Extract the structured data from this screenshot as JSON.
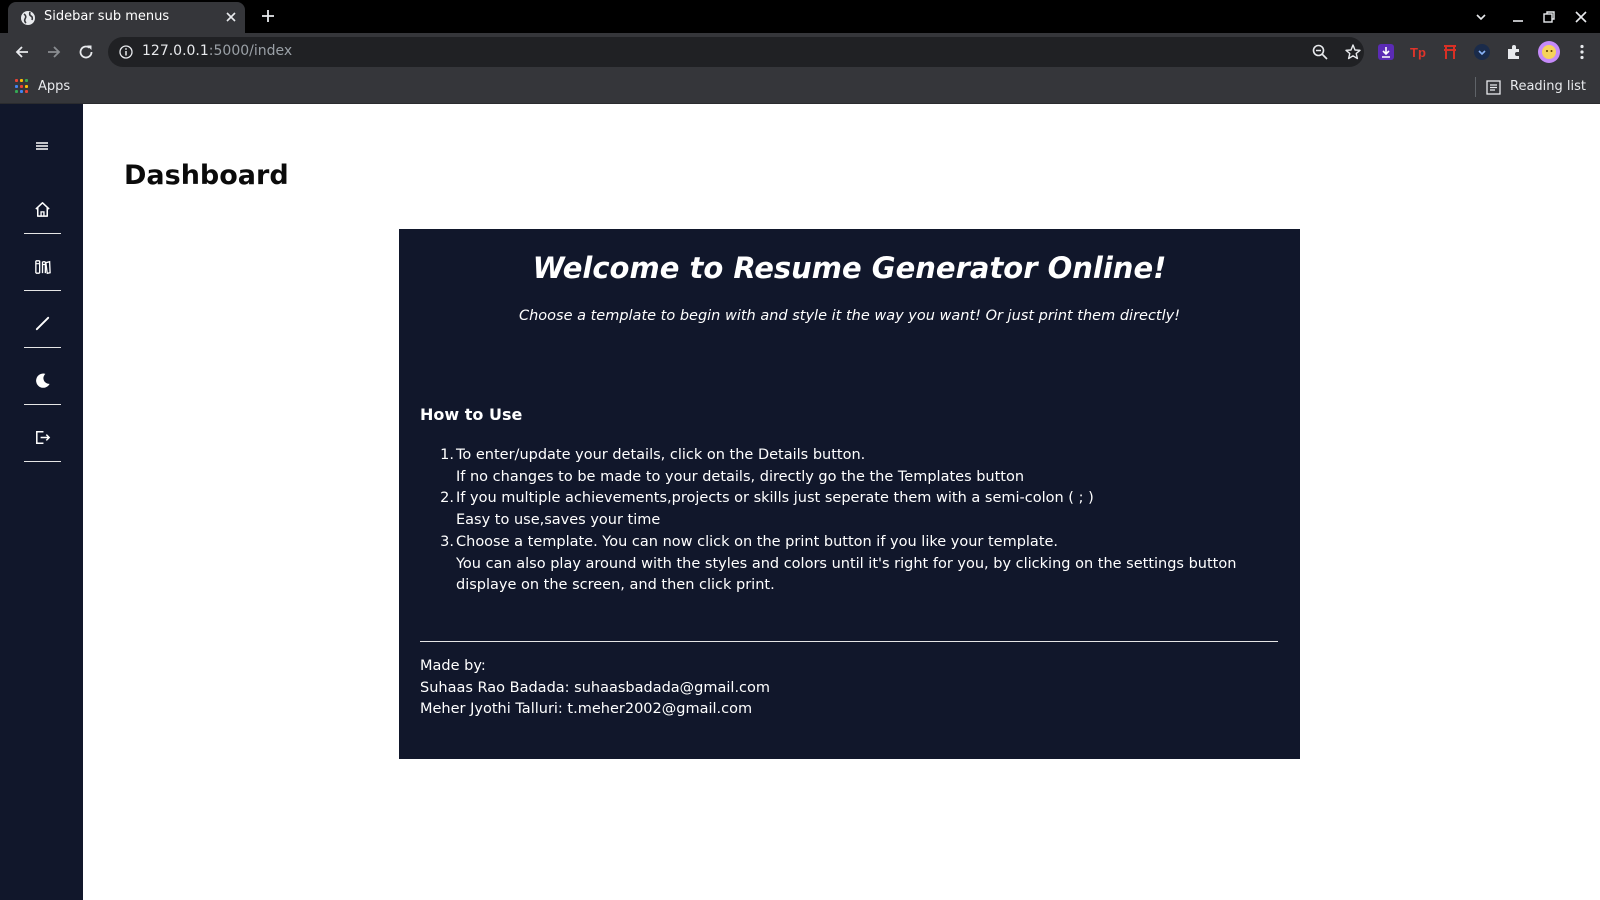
{
  "browser": {
    "tab": {
      "title": "Sidebar sub menus",
      "favicon": "globe-icon"
    },
    "url": {
      "host": "127.0.0.1",
      "path": ":5000/index"
    },
    "bookmarks": {
      "apps_label": "Apps",
      "reading_list_label": "Reading list"
    },
    "extensions": [
      "download-extension-icon",
      "tp-extension-icon",
      "bookmark-extension-icon",
      "dark-extension-icon",
      "puzzle-extensions-icon",
      "profile-avatar"
    ]
  },
  "sidebar": {
    "menu_icon": "hamburger-icon",
    "items": [
      {
        "icon": "home-icon"
      },
      {
        "icon": "library-icon"
      },
      {
        "icon": "pen-icon"
      },
      {
        "icon": "moon-icon"
      },
      {
        "icon": "logout-icon"
      }
    ]
  },
  "main": {
    "title": "Dashboard",
    "card": {
      "heading": "Welcome to Resume Generator Online!",
      "subheading": "Choose a template to begin with and style it the way you want! Or just print them directly!",
      "howto_title": "How to Use",
      "steps": [
        {
          "num": "1.",
          "line1": "To enter/update your details, click on the Details button.",
          "line2": "If no changes to be made to your details, directly go the the Templates button"
        },
        {
          "num": "2.",
          "line1": "If you multiple achievements,projects or skills just seperate them with a semi-colon ( ; )",
          "line2": "Easy to use,saves your time"
        },
        {
          "num": "3.",
          "line1": "Choose a template. You can now click on the print button if you like your template.",
          "line2": "You can also play around with the styles and colors until it's right for you, by clicking on the settings button displaye on the screen, and then click print."
        }
      ],
      "credits": {
        "label": "Made by:",
        "authors": [
          "Suhaas Rao Badada: suhaasbadada@gmail.com",
          "Meher Jyothi Talluri: t.meher2002@gmail.com"
        ]
      }
    }
  },
  "colors": {
    "sidebar_bg": "#11172b",
    "card_bg": "#11172b",
    "chrome_bg": "#35363a",
    "tabstrip_bg": "#000000"
  }
}
